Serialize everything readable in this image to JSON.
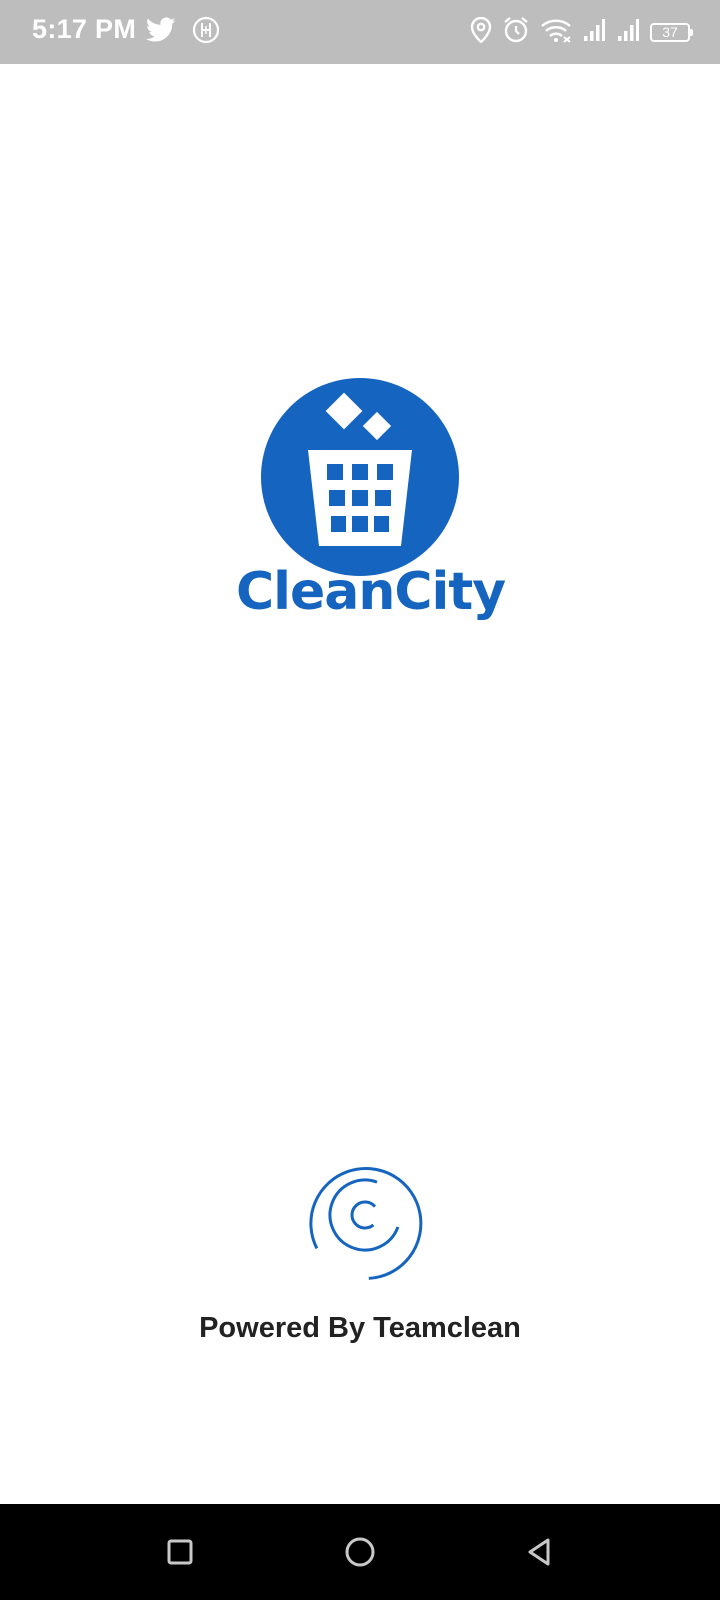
{
  "status_bar": {
    "time": "5:17 PM",
    "battery_level": "37",
    "left_icons": [
      "twitter-icon",
      "notification-app-icon"
    ],
    "right_icons": [
      "location-icon",
      "alarm-icon",
      "wifi-icon",
      "signal-icon",
      "signal-icon",
      "battery-icon"
    ]
  },
  "app": {
    "name": "CleanCity",
    "powered_by": "Powered By Teamclean"
  },
  "colors": {
    "brand": "#1565c0",
    "status_bar": "#bdbdbd",
    "nav_bar": "#000000"
  },
  "nav_bar": {
    "buttons": [
      "recent-apps-button",
      "home-button",
      "back-button"
    ]
  }
}
